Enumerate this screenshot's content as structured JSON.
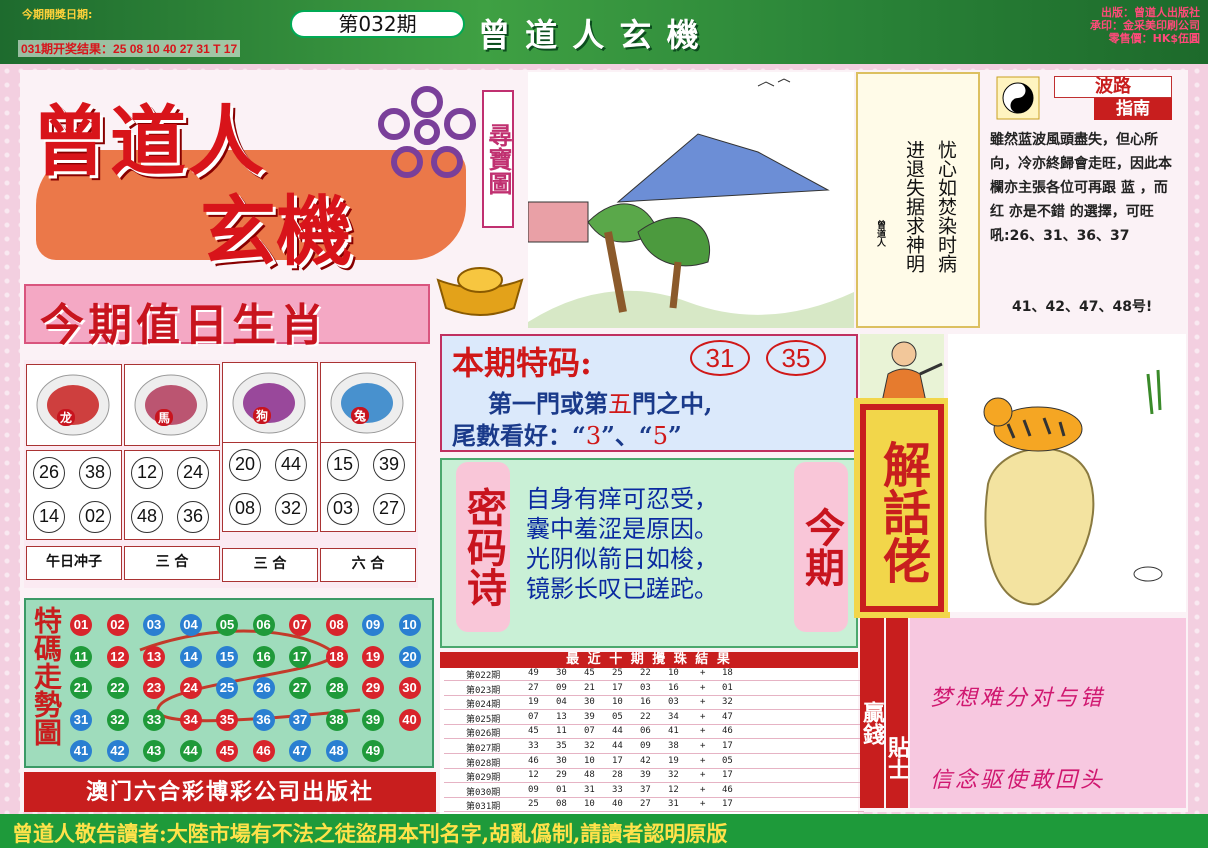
{
  "header": {
    "open_date_label": "今期開獎日期:",
    "issue_label": "第032期",
    "last_result": "031期开奖结果：25 08 10 40 27 31 T 17",
    "title": "曾 道 人 玄 機",
    "publisher_lines": [
      "出版：曾道人出版社",
      "承印：金采美印刷公司",
      "零售價：HK$伍圓"
    ]
  },
  "logo": {
    "line1": "曾道人",
    "line2": "玄機",
    "side_tag": "尋寶圖"
  },
  "riddle": {
    "col1": "忧心如焚染时病",
    "col2": "进退失据求神明",
    "signature": "曾道人"
  },
  "bolu": {
    "title1": "波路",
    "title2": "指南",
    "text": "雖然蓝波風頭盡失，但心所向，冷亦終歸會走旺，因此本欄亦主張各位可再跟 蓝 ，而 红 亦是不錯 的選擇，可旺吼:26、31、36、37",
    "text2": "41、42、47、48号!"
  },
  "zodiac": {
    "title": "今期值日生肖",
    "animals": [
      {
        "name": "龙",
        "color": "#c8201e",
        "numbers": [
          "26",
          "38",
          "14",
          "02"
        ],
        "relation": "午日冲子"
      },
      {
        "name": "馬",
        "color": "#b23a5a",
        "numbers": [
          "12",
          "24",
          "48",
          "36"
        ],
        "relation": "三 合"
      },
      {
        "name": "狗",
        "color": "#8a2a8c",
        "numbers": [
          "20",
          "44",
          "08",
          "32"
        ],
        "relation": "三 合"
      },
      {
        "name": "兔",
        "color": "#2a80c8",
        "numbers": [
          "15",
          "39",
          "03",
          "27"
        ],
        "relation": "六 合"
      }
    ]
  },
  "special": {
    "label": "本期特码:",
    "numbers": [
      "31",
      "35"
    ],
    "line1_a": "第一門或第",
    "line1_b": "五",
    "line1_c": "門之中,",
    "line2_a": "尾數看好：“",
    "tail1": "3",
    "line2_b": "”、“",
    "tail2": "5",
    "line2_c": "”"
  },
  "poem": {
    "left_label": "密码诗",
    "right_label": "今期",
    "lines": [
      "自身有痒可忍受，",
      "囊中羞涩是原因。",
      "光阴似箭日如梭，",
      "镜影长叹已蹉跎。"
    ]
  },
  "jiehua": {
    "label": "解話佬"
  },
  "tips": {
    "label1": "贏錢",
    "label2": "貼士",
    "line1": "梦想难分对与错",
    "line2": "信念驱使敢回头"
  },
  "trend": {
    "label": "特碼走勢圖",
    "balls": [
      {
        "n": "01",
        "c": "red"
      },
      {
        "n": "02",
        "c": "red"
      },
      {
        "n": "03",
        "c": "blue"
      },
      {
        "n": "04",
        "c": "blue"
      },
      {
        "n": "05",
        "c": "green"
      },
      {
        "n": "06",
        "c": "green"
      },
      {
        "n": "07",
        "c": "red"
      },
      {
        "n": "08",
        "c": "red"
      },
      {
        "n": "09",
        "c": "blue"
      },
      {
        "n": "10",
        "c": "blue"
      },
      {
        "n": "11",
        "c": "green"
      },
      {
        "n": "12",
        "c": "red"
      },
      {
        "n": "13",
        "c": "red"
      },
      {
        "n": "14",
        "c": "blue"
      },
      {
        "n": "15",
        "c": "blue"
      },
      {
        "n": "16",
        "c": "green"
      },
      {
        "n": "17",
        "c": "green"
      },
      {
        "n": "18",
        "c": "red"
      },
      {
        "n": "19",
        "c": "red"
      },
      {
        "n": "20",
        "c": "blue"
      },
      {
        "n": "21",
        "c": "green"
      },
      {
        "n": "22",
        "c": "green"
      },
      {
        "n": "23",
        "c": "red"
      },
      {
        "n": "24",
        "c": "red"
      },
      {
        "n": "25",
        "c": "blue"
      },
      {
        "n": "26",
        "c": "blue"
      },
      {
        "n": "27",
        "c": "green"
      },
      {
        "n": "28",
        "c": "green"
      },
      {
        "n": "29",
        "c": "red"
      },
      {
        "n": "30",
        "c": "red"
      },
      {
        "n": "31",
        "c": "blue"
      },
      {
        "n": "32",
        "c": "green"
      },
      {
        "n": "33",
        "c": "green"
      },
      {
        "n": "34",
        "c": "red"
      },
      {
        "n": "35",
        "c": "red"
      },
      {
        "n": "36",
        "c": "blue"
      },
      {
        "n": "37",
        "c": "blue"
      },
      {
        "n": "38",
        "c": "green"
      },
      {
        "n": "39",
        "c": "green"
      },
      {
        "n": "40",
        "c": "red"
      },
      {
        "n": "41",
        "c": "blue"
      },
      {
        "n": "42",
        "c": "blue"
      },
      {
        "n": "43",
        "c": "green"
      },
      {
        "n": "44",
        "c": "green"
      },
      {
        "n": "45",
        "c": "red"
      },
      {
        "n": "46",
        "c": "red"
      },
      {
        "n": "47",
        "c": "blue"
      },
      {
        "n": "48",
        "c": "blue"
      },
      {
        "n": "49",
        "c": "green"
      }
    ]
  },
  "history": {
    "title": "最 近 十 期 攪 珠 結 果",
    "rows": [
      {
        "issue": "第022期",
        "nums": [
          "49",
          "30",
          "45",
          "25",
          "22",
          "10"
        ],
        "sp": "18"
      },
      {
        "issue": "第023期",
        "nums": [
          "27",
          "09",
          "21",
          "17",
          "03",
          "16"
        ],
        "sp": "01"
      },
      {
        "issue": "第024期",
        "nums": [
          "19",
          "04",
          "30",
          "10",
          "16",
          "03"
        ],
        "sp": "32"
      },
      {
        "issue": "第025期",
        "nums": [
          "07",
          "13",
          "39",
          "05",
          "22",
          "34"
        ],
        "sp": "47"
      },
      {
        "issue": "第026期",
        "nums": [
          "45",
          "11",
          "07",
          "44",
          "06",
          "41"
        ],
        "sp": "46"
      },
      {
        "issue": "第027期",
        "nums": [
          "33",
          "35",
          "32",
          "44",
          "09",
          "38"
        ],
        "sp": "17"
      },
      {
        "issue": "第028期",
        "nums": [
          "46",
          "30",
          "10",
          "17",
          "42",
          "19"
        ],
        "sp": "05"
      },
      {
        "issue": "第029期",
        "nums": [
          "12",
          "29",
          "48",
          "28",
          "39",
          "32"
        ],
        "sp": "17"
      },
      {
        "issue": "第030期",
        "nums": [
          "09",
          "01",
          "31",
          "33",
          "37",
          "12"
        ],
        "sp": "46"
      },
      {
        "issue": "第031期",
        "nums": [
          "25",
          "08",
          "10",
          "40",
          "27",
          "31"
        ],
        "sp": "17"
      }
    ]
  },
  "publisher_box": "澳门六合彩博彩公司出版社",
  "footer": "曾道人敬告讀者:大陸市場有不法之徒盜用本刊名字,胡亂僞制,請讀者認明原版"
}
